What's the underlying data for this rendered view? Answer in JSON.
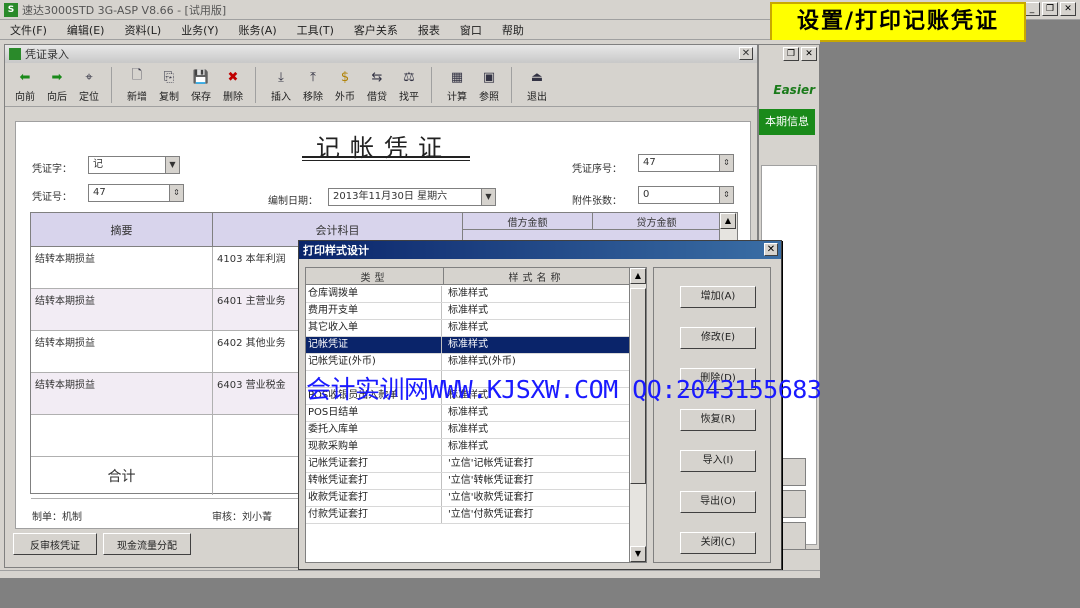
{
  "app": {
    "title": "速达3000STD 3G-ASP V8.66 - [试用版]"
  },
  "callout": "设置/打印记账凭证",
  "menu": [
    "文件(F)",
    "编辑(E)",
    "资料(L)",
    "业务(Y)",
    "账务(A)",
    "工具(T)",
    "客户关系",
    "报表",
    "窗口",
    "帮助"
  ],
  "voucher_window": {
    "title": "凭证录入",
    "toolbar": [
      {
        "icon": "arrow-left-icon",
        "label": "向前"
      },
      {
        "icon": "arrow-right-icon",
        "label": "向后"
      },
      {
        "icon": "locate-icon",
        "label": "定位"
      },
      {
        "icon": "new-doc-icon",
        "label": "新增"
      },
      {
        "icon": "copy-icon",
        "label": "复制"
      },
      {
        "icon": "save-icon",
        "label": "保存"
      },
      {
        "icon": "delete-icon",
        "label": "删除"
      },
      {
        "icon": "insert-row-icon",
        "label": "插入"
      },
      {
        "icon": "remove-row-icon",
        "label": "移除"
      },
      {
        "icon": "currency-icon",
        "label": "外币"
      },
      {
        "icon": "balance-icon",
        "label": "借贷"
      },
      {
        "icon": "level-icon",
        "label": "找平"
      },
      {
        "icon": "calculator-icon",
        "label": "计算"
      },
      {
        "icon": "reference-icon",
        "label": "参照"
      },
      {
        "icon": "exit-icon",
        "label": "退出"
      }
    ],
    "heading": "记帐凭证",
    "fields": {
      "voucher_word_label": "凭证字：",
      "voucher_word": "记",
      "voucher_no_label": "凭证号：",
      "voucher_no": "47",
      "date_label": "编制日期：",
      "date": "2013年11月30日 星期六",
      "seq_label": "凭证序号：",
      "seq": "47",
      "attach_label": "附件张数：",
      "attach": "0"
    },
    "grid": {
      "headers": {
        "summary": "摘要",
        "account": "会计科目",
        "debit": "借方金额",
        "credit": "贷方金额"
      },
      "rows": [
        {
          "summary": "结转本期损益",
          "account": "4103 本年利润"
        },
        {
          "summary": "结转本期损益",
          "account": "6401 主营业务"
        },
        {
          "summary": "结转本期损益",
          "account": "6402 其他业务"
        },
        {
          "summary": "结转本期损益",
          "account": "6403 营业税金"
        }
      ],
      "total_label": "合计"
    },
    "footer": {
      "maker": "制单：机制",
      "auditor": "审核：刘小菁"
    },
    "buttons": {
      "reverse": "反审核凭证",
      "cashflow": "现金流量分配"
    }
  },
  "dialog": {
    "title": "打印样式设计",
    "col_type": "类型",
    "col_style": "样式名称",
    "rows": [
      {
        "type": "仓库调拨单",
        "style": "标准样式"
      },
      {
        "type": "费用开支单",
        "style": "标准样式"
      },
      {
        "type": "其它收入单",
        "style": "标准样式"
      },
      {
        "type": "记帐凭证",
        "style": "标准样式"
      },
      {
        "type": "记帐凭证(外币)",
        "style": "标准样式(外币)"
      },
      {
        "type": "",
        "style": ""
      },
      {
        "type": "POS收银员出入款单",
        "style": "标准样式"
      },
      {
        "type": "POS日结单",
        "style": "标准样式"
      },
      {
        "type": "委托入库单",
        "style": "标准样式"
      },
      {
        "type": "现款采购单",
        "style": "标准样式"
      },
      {
        "type": "记帐凭证套打",
        "style": "'立信'记帐凭证套打"
      },
      {
        "type": "转帐凭证套打",
        "style": "'立信'转帐凭证套打"
      },
      {
        "type": "收款凭证套打",
        "style": "'立信'收款凭证套打"
      },
      {
        "type": "付款凭证套打",
        "style": "'立信'付款凭证套打"
      }
    ],
    "selected_index": 3,
    "buttons": [
      "增加(A)",
      "修改(E)",
      "删除(D)",
      "恢复(R)",
      "导入(I)",
      "导出(O)",
      "关闭(C)"
    ]
  },
  "watermark": "会计实训网WWW.KJSXW.COM  QQ:2043155683",
  "right_window": {
    "logo": "Easier",
    "banner": "本期信息"
  }
}
